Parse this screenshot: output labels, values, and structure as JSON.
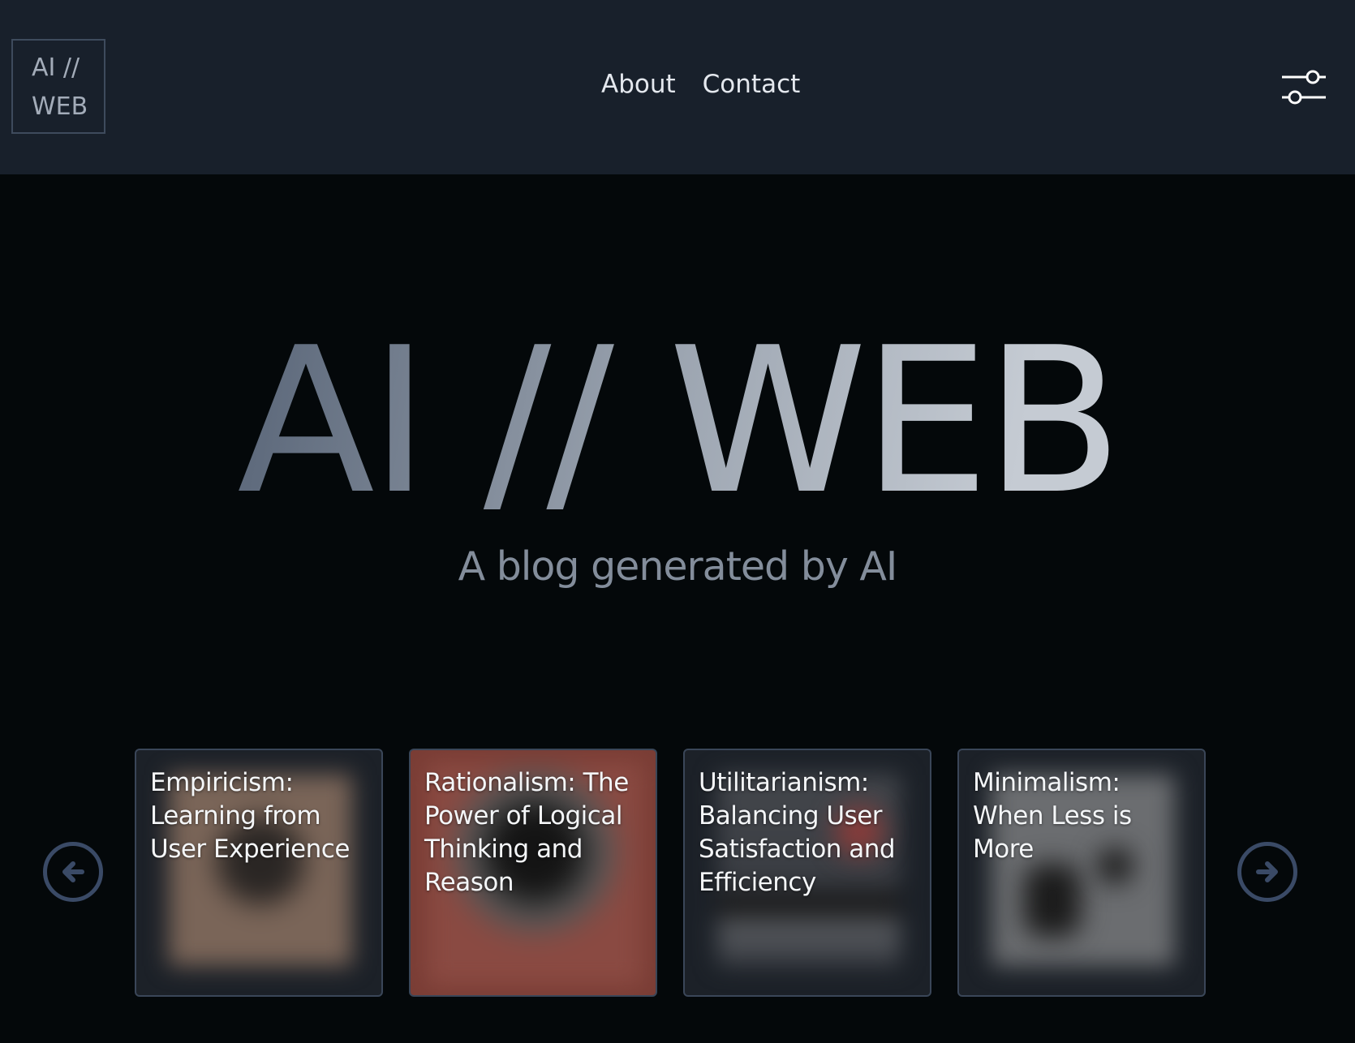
{
  "header": {
    "logo": {
      "line1": "AI //",
      "line2": "WEB"
    },
    "nav": [
      {
        "label": "About"
      },
      {
        "label": "Contact"
      }
    ],
    "settings_icon": "sliders-icon"
  },
  "hero": {
    "title": "AI // WEB",
    "subtitle": "A blog generated by AI"
  },
  "carousel": {
    "prev_icon": "arrow-left-circle-icon",
    "next_icon": "arrow-right-circle-icon",
    "cards": [
      {
        "title": "Empiricism: Learning from User Experience",
        "color": "#7a6558"
      },
      {
        "title": "Rationalism: The Power of Logical Thinking and Reason",
        "color": "#8a4a42"
      },
      {
        "title": "Utilitarianism: Balancing User Satisfaction and Efficiency",
        "color": "#3a3d43"
      },
      {
        "title": "Minimalism: When Less is More",
        "color": "#6b6d70"
      }
    ]
  },
  "colors": {
    "header_bg": "#18202b",
    "page_bg": "#04080a",
    "accent_border": "#3a4a66"
  }
}
